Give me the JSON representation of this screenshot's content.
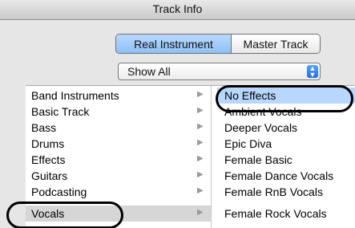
{
  "window": {
    "title": "Track Info"
  },
  "mode_toggle": {
    "options": [
      "Real Instrument",
      "Master Track"
    ]
  },
  "filter": {
    "selected": "Show All"
  },
  "categories": {
    "items": [
      {
        "label": "Band Instruments"
      },
      {
        "label": "Basic Track"
      },
      {
        "label": "Bass"
      },
      {
        "label": "Drums"
      },
      {
        "label": "Effects"
      },
      {
        "label": "Guitars"
      },
      {
        "label": "Podcasting"
      },
      {
        "label": "Vocals",
        "selected": true
      }
    ]
  },
  "presets": {
    "items": [
      {
        "label": "No Effects",
        "selected": true
      },
      {
        "label": "Ambient Vocals"
      },
      {
        "label": "Deeper Vocals"
      },
      {
        "label": "Epic Diva"
      },
      {
        "label": "Female Basic"
      },
      {
        "label": "Female Dance Vocals"
      },
      {
        "label": "Female RnB Vocals"
      },
      {
        "label": "Female Rock Vocals"
      }
    ]
  }
}
